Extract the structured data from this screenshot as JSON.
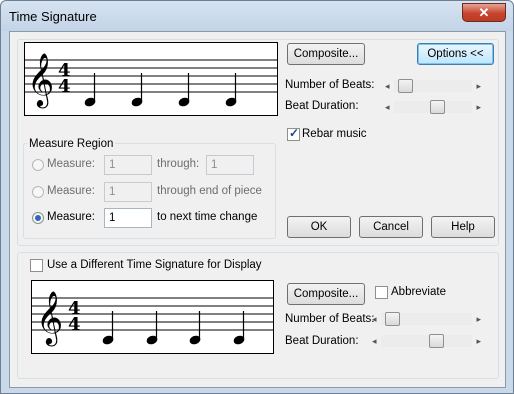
{
  "window": {
    "title": "Time Signature",
    "close_glyph": "✕"
  },
  "top": {
    "composite_label": "Composite...",
    "options_label": "Options <<",
    "number_of_beats_label": "Number of Beats:",
    "beat_duration_label": "Beat Duration:",
    "rebar_label": "Rebar music",
    "rebar_checked": true,
    "time_sig": {
      "numerator": "4",
      "denominator": "4"
    }
  },
  "measure_region": {
    "legend": "Measure Region",
    "rows": [
      {
        "label": "Measure:",
        "value": "1",
        "suffix": "through:",
        "suffix_value": "1",
        "selected": false,
        "enabled": false
      },
      {
        "label": "Measure:",
        "value": "1",
        "suffix": "through end of piece",
        "selected": false,
        "enabled": false
      },
      {
        "label": "Measure:",
        "value": "1",
        "suffix": "to next time change",
        "selected": true,
        "enabled": true
      }
    ]
  },
  "buttons": {
    "ok": "OK",
    "cancel": "Cancel",
    "help": "Help"
  },
  "bottom": {
    "use_different_label": "Use a Different Time Signature for Display",
    "use_different_checked": false,
    "composite_label": "Composite...",
    "abbreviate_label": "Abbreviate",
    "abbreviate_checked": false,
    "number_of_beats_label": "Number of Beats:",
    "beat_duration_label": "Beat Duration:",
    "time_sig": {
      "numerator": "4",
      "denominator": "4"
    }
  },
  "sliders": {
    "top_beats_position": 0.08,
    "top_duration_position": 0.55,
    "bottom_beats_position": 0.08,
    "bottom_duration_position": 0.55
  },
  "icons": {
    "close": "close-icon",
    "checkmark": "checkmark-icon",
    "slider_left": "arrow-left-icon",
    "slider_right": "arrow-right-icon"
  }
}
